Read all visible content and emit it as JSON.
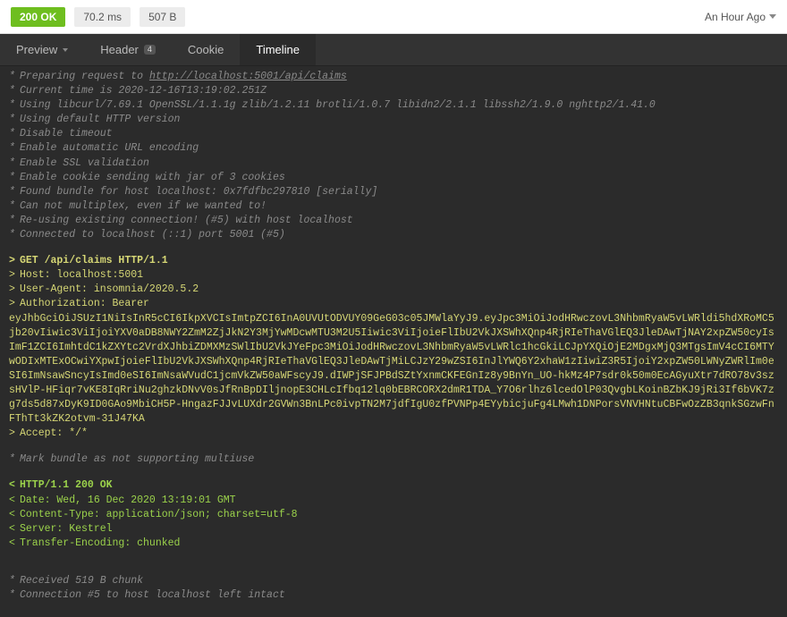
{
  "topbar": {
    "status_code": "200",
    "status_text": "OK",
    "response_time": "70.2 ms",
    "response_size": "507 B",
    "time_ago": "An Hour Ago"
  },
  "tabs": {
    "preview": "Preview",
    "header": "Header",
    "header_badge": "4",
    "cookie": "Cookie",
    "timeline": "Timeline"
  },
  "log": {
    "info1": [
      "Preparing request to ",
      "Current time is 2020-12-16T13:19:02.251Z",
      "Using libcurl/7.69.1 OpenSSL/1.1.1g zlib/1.2.11 brotli/1.0.7 libidn2/2.1.1 libssh2/1.9.0 nghttp2/1.41.0",
      "Using default HTTP version",
      "Disable timeout",
      "Enable automatic URL encoding",
      "Enable SSL validation",
      "Enable cookie sending with jar of 3 cookies",
      "Found bundle for host localhost: 0x7fdfbc297810 [serially]",
      "Can not multiplex, even if we wanted to!",
      "Re-using existing connection! (#5) with host localhost",
      "Connected to localhost (::1) port 5001 (#5)"
    ],
    "request_url": "http://localhost:5001/api/claims",
    "request": {
      "line1": "GET /api/claims HTTP/1.1",
      "host": "Host: localhost:5001",
      "ua": "User-Agent: insomnia/2020.5.2",
      "auth_label": "Authorization: Bearer",
      "token": "eyJhbGciOiJSUzI1NiIsInR5cCI6IkpXVCIsImtpZCI6InA0UVUtODVUY09GeG03c05JMWlaYyJ9.eyJpc3MiOiJodHRwczovL3NhbmRyaW5vLWRldi5hdXRoMC5jb20vIiwic3ViIjoiYXV0aDB8NWY2ZmM2ZjJkN2Y3MjYwMDcwMTU3M2U5Iiwic3ViIjoieFlIbU2VkJXSWhXQnp4RjRIeThaVGlEQ3JleDAwTjNAY2xpZW50cyIsImF1ZCI6ImhtdC1kZXYtc2VrdXJhbiZDMXMzSWlIbU2VkJYeFpc3MiOiJodHRwczovL3NhbmRyaW5vLWRlc1hcGkiLCJpYXQiOjE2MDgxMjQ3MTgsImV4cCI6MTYwODIxMTExOCwiYXpwIjoieFlIbU2VkJXSWhXQnp4RjRIeThaVGlEQ3JleDAwTjMiLCJzY29wZSI6InJlYWQ6Y2xhaW1zIiwiZ3R5IjoiY2xpZW50LWNyZWRlIm0eSI6ImNsawSncyIsImd0eSI6ImNsaWVudC1jcmVkZW50aWFscyJ9.dIWPjSFJPBdSZtYxnmCKFEGnIz8y9BnYn_UO-hkMz4P7sdr0k50m0EcAGyuXtr7dRO78v3szsHVlP-HFiqr7vKE8IqRriNu2ghzkDNvV0sJfRnBpDIljnopE3CHLcIfbq12lq0bEBRCORX2dmR1TDA_Y7O6rlhz6lcedOlP03QvgbLKoinBZbKJ9jRi3If6bVK7zg7ds5d87xDyK9ID0GAo9MbiCH5P-HngazFJJvLUXdr2GVWn3BnLPc0ivpTN2M7jdfIgU0zfPVNPp4EYybicjuFg4LMwh1DNPorsVNVHNtuCBFwOzZB3qnkSGzwFnFThTt3kZK2otvm-31J47KA",
      "accept": "Accept: */*"
    },
    "info2": "Mark bundle as not supporting multiuse",
    "response": {
      "status": "HTTP/1.1 200 OK",
      "date": "Date: Wed, 16 Dec 2020 13:19:01 GMT",
      "ctype": "Content-Type: application/json; charset=utf-8",
      "server": "Server: Kestrel",
      "te": "Transfer-Encoding: chunked"
    },
    "info3": [
      "Received 519 B chunk",
      "Connection #5 to host localhost left intact"
    ]
  }
}
